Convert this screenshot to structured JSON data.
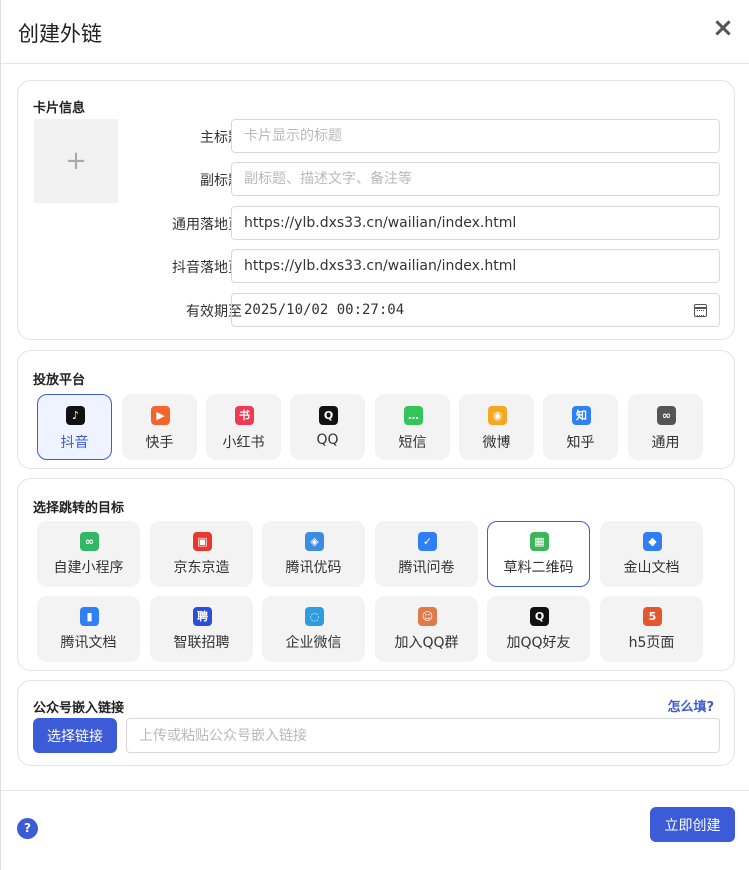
{
  "dialog": {
    "title": "创建外链",
    "close": "×"
  },
  "card_info": {
    "title": "卡片信息",
    "upload_symbol": "+",
    "fields": {
      "main_title": {
        "label": "主标题",
        "value": "",
        "placeholder": "卡片显示的标题"
      },
      "sub_title": {
        "label": "副标题",
        "value": "",
        "placeholder": "副标题、描述文字、备注等"
      },
      "general_page": {
        "label": "通用落地页",
        "value": "https://ylb.dxs33.cn/wailian/index.html"
      },
      "douyin_page": {
        "label": "抖音落地页",
        "value": "https://ylb.dxs33.cn/wailian/index.html"
      },
      "expiry": {
        "label": "有效期至",
        "value": "2025/10/02 00:27:04"
      }
    }
  },
  "platforms": {
    "title": "投放平台",
    "selected": "抖音",
    "items": [
      {
        "label": "抖音",
        "icon": "douyin-icon",
        "color": "#111111",
        "glyph": "♪"
      },
      {
        "label": "快手",
        "icon": "kuaishou-icon",
        "color": "#f5652b",
        "glyph": "▶"
      },
      {
        "label": "小红书",
        "icon": "xiaohongshu-icon",
        "color": "#f03a52",
        "glyph": "书"
      },
      {
        "label": "QQ",
        "icon": "qq-icon",
        "color": "#111111",
        "glyph": "Q"
      },
      {
        "label": "短信",
        "icon": "sms-icon",
        "color": "#35c45a",
        "glyph": "…"
      },
      {
        "label": "微博",
        "icon": "weibo-icon",
        "color": "#f5a623",
        "glyph": "◉"
      },
      {
        "label": "知乎",
        "icon": "zhihu-icon",
        "color": "#2f7ff5",
        "glyph": "知"
      },
      {
        "label": "通用",
        "icon": "link-icon",
        "color": "#555555",
        "glyph": "∞"
      }
    ]
  },
  "targets": {
    "title": "选择跳转的目标",
    "selected": "草料二维码",
    "items": [
      {
        "label": "自建小程序",
        "icon": "mini-program-icon",
        "color": "#2fb866",
        "glyph": "∞"
      },
      {
        "label": "京东京造",
        "icon": "jd-icon",
        "color": "#e8382e",
        "glyph": "▣"
      },
      {
        "label": "腾讯优码",
        "icon": "tencent-code-icon",
        "color": "#3a8de0",
        "glyph": "◈"
      },
      {
        "label": "腾讯问卷",
        "icon": "tencent-survey-icon",
        "color": "#2f7ff5",
        "glyph": "✓"
      },
      {
        "label": "草料二维码",
        "icon": "qrcode-icon",
        "color": "#3fb45a",
        "glyph": "▦"
      },
      {
        "label": "金山文档",
        "icon": "kdocs-icon",
        "color": "#2f7ff5",
        "glyph": "◆"
      },
      {
        "label": "腾讯文档",
        "icon": "tencent-docs-icon",
        "color": "#2f7ff5",
        "glyph": "▮"
      },
      {
        "label": "智联招聘",
        "icon": "zhaopin-icon",
        "color": "#2b50d8",
        "glyph": "聘"
      },
      {
        "label": "企业微信",
        "icon": "wecom-icon",
        "color": "#2f9be0",
        "glyph": "◌"
      },
      {
        "label": "加入QQ群",
        "icon": "qq-group-icon",
        "color": "#e07a4a",
        "glyph": "☺"
      },
      {
        "label": "加QQ好友",
        "icon": "qq-friend-icon",
        "color": "#111111",
        "glyph": "Q"
      },
      {
        "label": "h5页面",
        "icon": "html5-icon",
        "color": "#e4572e",
        "glyph": "5"
      }
    ]
  },
  "embed": {
    "title": "公众号嵌入链接",
    "help_link": "怎么填?",
    "button": "选择链接",
    "placeholder": "上传或粘贴公众号嵌入链接",
    "value": ""
  },
  "footer": {
    "help": "?",
    "submit": "立即创建"
  },
  "colors": {
    "accent": "#3c5bd6",
    "tile_bg": "#f3f3f3"
  }
}
